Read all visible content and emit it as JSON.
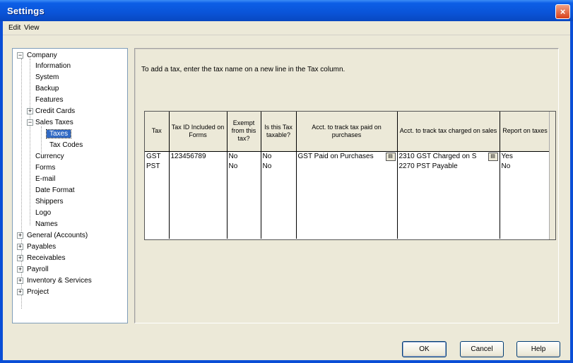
{
  "window": {
    "title": "Settings",
    "close_label": "×",
    "accent_color": "#0a4ed6"
  },
  "menu": {
    "items": [
      "Edit",
      "View"
    ]
  },
  "tree": {
    "items": [
      {
        "label": "Company",
        "expander": "−"
      },
      {
        "label": "Information"
      },
      {
        "label": "System"
      },
      {
        "label": "Backup"
      },
      {
        "label": "Features"
      },
      {
        "label": "Credit Cards",
        "expander": "+"
      },
      {
        "label": "Sales Taxes",
        "expander": "−"
      },
      {
        "label": "Taxes",
        "selected": true
      },
      {
        "label": "Tax Codes"
      },
      {
        "label": "Currency"
      },
      {
        "label": "Forms"
      },
      {
        "label": "E-mail"
      },
      {
        "label": "Date Format"
      },
      {
        "label": "Shippers"
      },
      {
        "label": "Logo"
      },
      {
        "label": "Names"
      },
      {
        "label": "General (Accounts)",
        "expander": "+"
      },
      {
        "label": "Payables",
        "expander": "+"
      },
      {
        "label": "Receivables",
        "expander": "+"
      },
      {
        "label": "Payroll",
        "expander": "+"
      },
      {
        "label": "Inventory & Services",
        "expander": "+"
      },
      {
        "label": "Project",
        "expander": "+"
      }
    ]
  },
  "content": {
    "instruction": "To add a tax, enter the tax name on a new line in the Tax column.",
    "columns": [
      "Tax",
      "Tax ID Included on Forms",
      "Exempt from this tax?",
      "Is this Tax taxable?",
      "Acct. to track tax paid on purchases",
      "Acct. to track tax charged on sales",
      "Report on taxes"
    ],
    "rows": [
      [
        "GST",
        "123456789",
        "No",
        "No",
        "GST Paid on Purchases",
        "2310 GST Charged on S",
        "Yes"
      ],
      [
        "PST",
        "",
        "No",
        "No",
        "",
        "2270 PST Payable",
        "No"
      ]
    ],
    "lookup_icon": "list-lookup-icon"
  },
  "buttons": {
    "ok": "OK",
    "cancel": "Cancel",
    "help": "Help"
  }
}
